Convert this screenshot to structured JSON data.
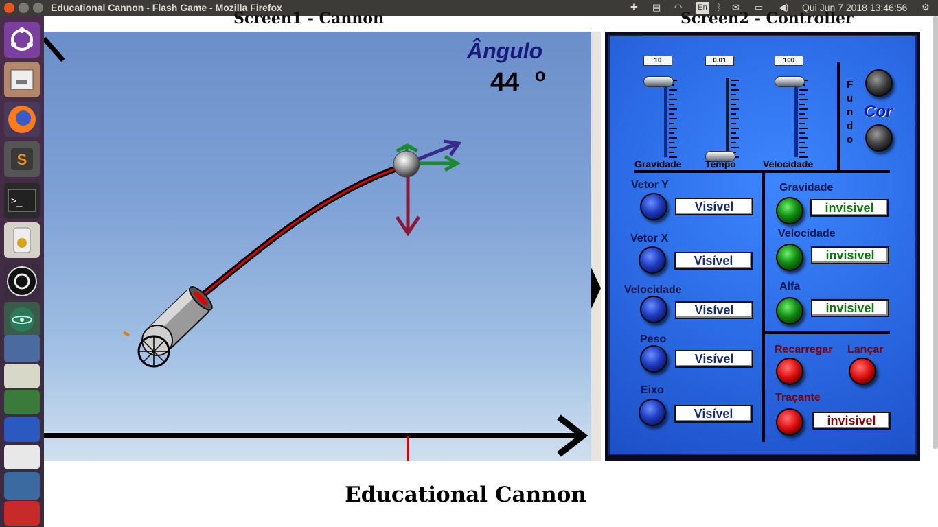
{
  "window": {
    "title": "Educational Cannon - Flash Game - Mozilla Firefox",
    "keyboard_layout": "En",
    "clock": "Qui Jun  7 2018 13:46:56"
  },
  "launcher": {
    "apps": [
      "ubuntu-dash-icon",
      "files-icon",
      "firefox-icon",
      "sublime-text-icon",
      "terminal-icon",
      "speaker-icon",
      "obs-icon",
      "atom-icon",
      "mail-icon",
      "editor-icon",
      "game-icon",
      "pager-icon",
      "penguin-icon",
      "text-icon"
    ]
  },
  "screen1": {
    "heading": "Screen1 - Cannon",
    "angle_label": "Ângulo",
    "angle_value": "44",
    "angle_unit": "o"
  },
  "screen2": {
    "heading": "Screen2 - Controller",
    "sliders": [
      {
        "name": "Gravidade",
        "value": "10",
        "level": 1.0
      },
      {
        "name": "Tempo",
        "value": "0.01",
        "level": 0.0
      },
      {
        "name": "Velocidade",
        "value": "100",
        "level": 1.0
      }
    ],
    "fundo_letters": [
      "F",
      "u",
      "n",
      "d",
      "o"
    ],
    "cor_label": "Cor",
    "left_controls": [
      {
        "label": "Vetor Y",
        "value": "Visível"
      },
      {
        "label": "Vetor X",
        "value": "Visível"
      },
      {
        "label": "Velocidade",
        "value": "Visível"
      },
      {
        "label": "Peso",
        "value": "Visível"
      },
      {
        "label": "Eixo",
        "value": "Visível"
      }
    ],
    "right_controls": [
      {
        "label": "Gravidade",
        "value": "invisivel"
      },
      {
        "label": "Velocidade",
        "value": "invisivel"
      },
      {
        "label": "Alfa",
        "value": "invisivel"
      }
    ],
    "actions": {
      "reload": "Recarregar",
      "launch": "Lançar",
      "tracer": "Traçante",
      "tracer_value": "invisivel"
    }
  },
  "page": {
    "title": "Educational Cannon"
  },
  "colors": {
    "sky_top": "#6a8fc9",
    "panel_blue": "#2d6ee8",
    "trajectory": "#e00000",
    "vector_green": "#1a8a2a",
    "vector_purple": "#3a2a8a",
    "vector_red": "#8a1a3a"
  }
}
